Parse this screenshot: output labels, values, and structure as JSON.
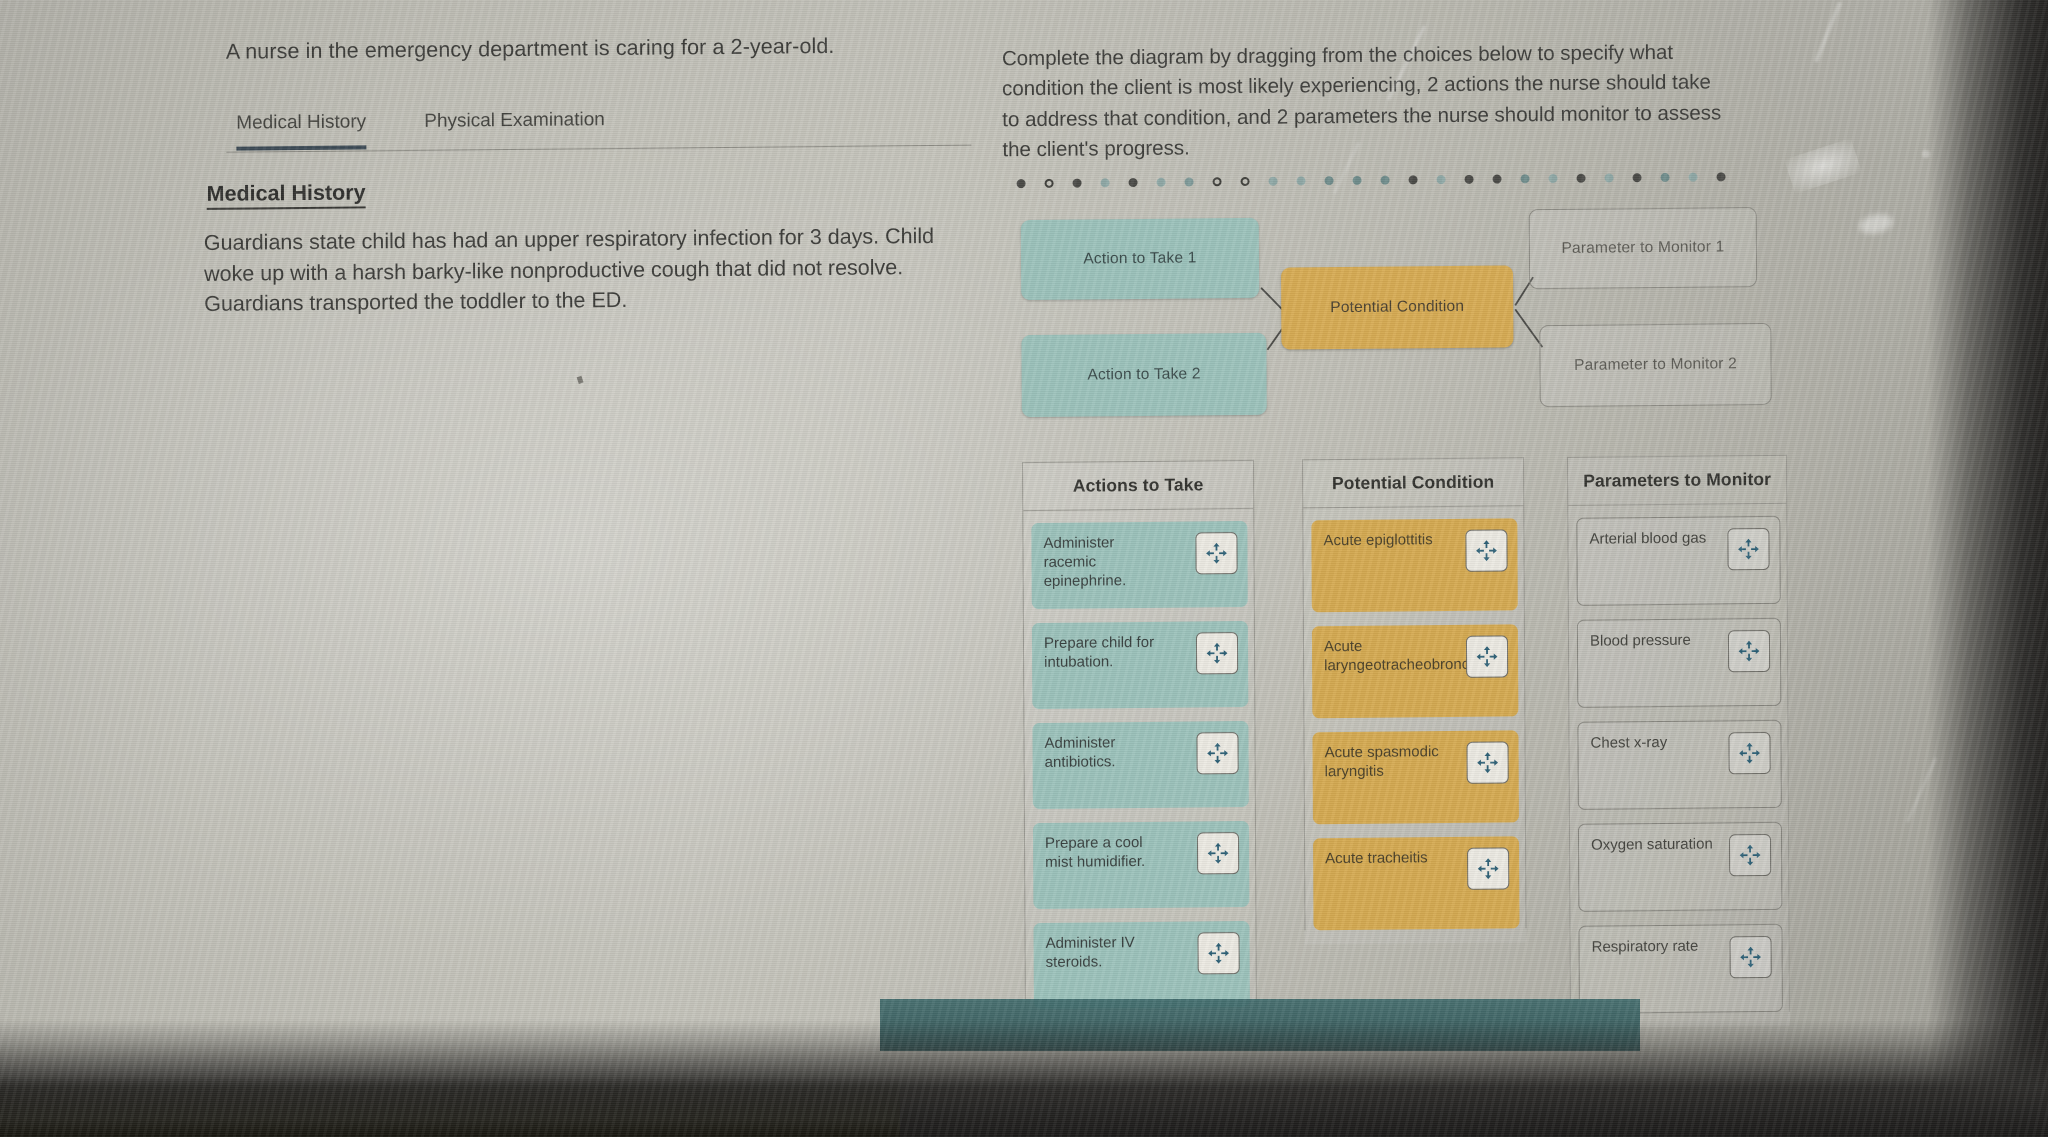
{
  "stem": "A nurse in the emergency department is caring for a 2-year-old.",
  "tabs": [
    {
      "label": "Medical History",
      "active": true
    },
    {
      "label": "Physical Examination",
      "active": false
    }
  ],
  "medical_history": {
    "title": "Medical History",
    "body": "Guardians state child has had an upper respiratory infection for 3 days. Child woke up with a harsh barky-like nonproductive cough that did not resolve. Guardians transported the toddler to the ED."
  },
  "instruction": "Complete the diagram by dragging from the choices below to specify what condition the client is most likely experiencing, 2 actions the nurse should take to address that condition, and 2 parameters the nurse should monitor to assess the client's progress.",
  "diagram": {
    "action_1": "Action to Take 1",
    "action_2": "Action to Take 2",
    "potential_condition": "Potential Condition",
    "parameter_1": "Parameter to Monitor 1",
    "parameter_2": "Parameter to Monitor 2"
  },
  "colors": {
    "action_fill": "#9cc2bb",
    "condition_fill": "#d7ab53",
    "parameter_fill": "transparent",
    "tab_underline": "#3c4a55",
    "drag_icon": "#2d6076"
  },
  "panels": [
    {
      "id": "actions",
      "header": "Actions to Take",
      "style": "teal",
      "items": [
        {
          "label": "Administer racemic epinephrine.",
          "icon": "drag-move-icon"
        },
        {
          "label": "Prepare child for intubation.",
          "icon": "drag-move-icon"
        },
        {
          "label": "Administer antibiotics.",
          "icon": "drag-move-icon"
        },
        {
          "label": "Prepare a cool mist humidifier.",
          "icon": "drag-move-icon"
        },
        {
          "label": "Administer IV steroids.",
          "icon": "drag-move-icon"
        }
      ]
    },
    {
      "id": "condition",
      "header": "Potential Condition",
      "style": "gold",
      "items": [
        {
          "label": "Acute epiglottitis",
          "icon": "drag-move-icon"
        },
        {
          "label": "Acute laryngeotracheobronchitis",
          "icon": "drag-move-icon"
        },
        {
          "label": "Acute spasmodic laryngitis",
          "icon": "drag-move-icon"
        },
        {
          "label": "Acute tracheitis",
          "icon": "drag-move-icon"
        }
      ]
    },
    {
      "id": "params",
      "header": "Parameters to Monitor",
      "style": "ghost",
      "items": [
        {
          "label": "Arterial blood gas",
          "icon": "drag-move-icon"
        },
        {
          "label": "Blood pressure",
          "icon": "drag-move-icon"
        },
        {
          "label": "Chest x-ray",
          "icon": "drag-move-icon"
        },
        {
          "label": "Oxygen saturation",
          "icon": "drag-move-icon"
        },
        {
          "label": "Respiratory rate",
          "icon": "drag-move-icon"
        }
      ]
    }
  ],
  "separator_dots": {
    "count": 26,
    "description": "dotted horizontal divider above diagram"
  }
}
